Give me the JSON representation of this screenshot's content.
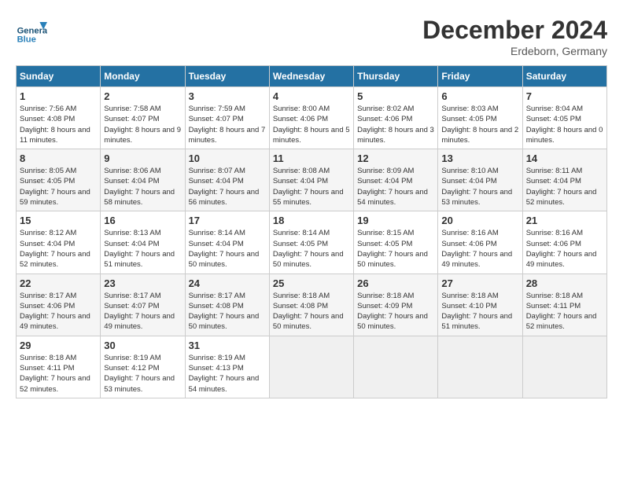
{
  "logo": {
    "general": "General",
    "blue": "Blue"
  },
  "header": {
    "month": "December 2024",
    "location": "Erdeborn, Germany"
  },
  "weekdays": [
    "Sunday",
    "Monday",
    "Tuesday",
    "Wednesday",
    "Thursday",
    "Friday",
    "Saturday"
  ],
  "days": [
    {
      "num": "",
      "sunrise": "",
      "sunset": "",
      "daylight": ""
    },
    {
      "num": "",
      "sunrise": "",
      "sunset": "",
      "daylight": ""
    },
    {
      "num": "",
      "sunrise": "",
      "sunset": "",
      "daylight": ""
    },
    {
      "num": "",
      "sunrise": "",
      "sunset": "",
      "daylight": ""
    },
    {
      "num": "",
      "sunrise": "",
      "sunset": "",
      "daylight": ""
    },
    {
      "num": "",
      "sunrise": "",
      "sunset": "",
      "daylight": ""
    },
    {
      "num": "",
      "sunrise": "",
      "sunset": "",
      "daylight": ""
    },
    {
      "num": "1",
      "sunrise": "Sunrise: 7:56 AM",
      "sunset": "Sunset: 4:08 PM",
      "daylight": "Daylight: 8 hours and 11 minutes."
    },
    {
      "num": "2",
      "sunrise": "Sunrise: 7:58 AM",
      "sunset": "Sunset: 4:07 PM",
      "daylight": "Daylight: 8 hours and 9 minutes."
    },
    {
      "num": "3",
      "sunrise": "Sunrise: 7:59 AM",
      "sunset": "Sunset: 4:07 PM",
      "daylight": "Daylight: 8 hours and 7 minutes."
    },
    {
      "num": "4",
      "sunrise": "Sunrise: 8:00 AM",
      "sunset": "Sunset: 4:06 PM",
      "daylight": "Daylight: 8 hours and 5 minutes."
    },
    {
      "num": "5",
      "sunrise": "Sunrise: 8:02 AM",
      "sunset": "Sunset: 4:06 PM",
      "daylight": "Daylight: 8 hours and 3 minutes."
    },
    {
      "num": "6",
      "sunrise": "Sunrise: 8:03 AM",
      "sunset": "Sunset: 4:05 PM",
      "daylight": "Daylight: 8 hours and 2 minutes."
    },
    {
      "num": "7",
      "sunrise": "Sunrise: 8:04 AM",
      "sunset": "Sunset: 4:05 PM",
      "daylight": "Daylight: 8 hours and 0 minutes."
    },
    {
      "num": "8",
      "sunrise": "Sunrise: 8:05 AM",
      "sunset": "Sunset: 4:05 PM",
      "daylight": "Daylight: 7 hours and 59 minutes."
    },
    {
      "num": "9",
      "sunrise": "Sunrise: 8:06 AM",
      "sunset": "Sunset: 4:04 PM",
      "daylight": "Daylight: 7 hours and 58 minutes."
    },
    {
      "num": "10",
      "sunrise": "Sunrise: 8:07 AM",
      "sunset": "Sunset: 4:04 PM",
      "daylight": "Daylight: 7 hours and 56 minutes."
    },
    {
      "num": "11",
      "sunrise": "Sunrise: 8:08 AM",
      "sunset": "Sunset: 4:04 PM",
      "daylight": "Daylight: 7 hours and 55 minutes."
    },
    {
      "num": "12",
      "sunrise": "Sunrise: 8:09 AM",
      "sunset": "Sunset: 4:04 PM",
      "daylight": "Daylight: 7 hours and 54 minutes."
    },
    {
      "num": "13",
      "sunrise": "Sunrise: 8:10 AM",
      "sunset": "Sunset: 4:04 PM",
      "daylight": "Daylight: 7 hours and 53 minutes."
    },
    {
      "num": "14",
      "sunrise": "Sunrise: 8:11 AM",
      "sunset": "Sunset: 4:04 PM",
      "daylight": "Daylight: 7 hours and 52 minutes."
    },
    {
      "num": "15",
      "sunrise": "Sunrise: 8:12 AM",
      "sunset": "Sunset: 4:04 PM",
      "daylight": "Daylight: 7 hours and 52 minutes."
    },
    {
      "num": "16",
      "sunrise": "Sunrise: 8:13 AM",
      "sunset": "Sunset: 4:04 PM",
      "daylight": "Daylight: 7 hours and 51 minutes."
    },
    {
      "num": "17",
      "sunrise": "Sunrise: 8:14 AM",
      "sunset": "Sunset: 4:04 PM",
      "daylight": "Daylight: 7 hours and 50 minutes."
    },
    {
      "num": "18",
      "sunrise": "Sunrise: 8:14 AM",
      "sunset": "Sunset: 4:05 PM",
      "daylight": "Daylight: 7 hours and 50 minutes."
    },
    {
      "num": "19",
      "sunrise": "Sunrise: 8:15 AM",
      "sunset": "Sunset: 4:05 PM",
      "daylight": "Daylight: 7 hours and 50 minutes."
    },
    {
      "num": "20",
      "sunrise": "Sunrise: 8:16 AM",
      "sunset": "Sunset: 4:06 PM",
      "daylight": "Daylight: 7 hours and 49 minutes."
    },
    {
      "num": "21",
      "sunrise": "Sunrise: 8:16 AM",
      "sunset": "Sunset: 4:06 PM",
      "daylight": "Daylight: 7 hours and 49 minutes."
    },
    {
      "num": "22",
      "sunrise": "Sunrise: 8:17 AM",
      "sunset": "Sunset: 4:06 PM",
      "daylight": "Daylight: 7 hours and 49 minutes."
    },
    {
      "num": "23",
      "sunrise": "Sunrise: 8:17 AM",
      "sunset": "Sunset: 4:07 PM",
      "daylight": "Daylight: 7 hours and 49 minutes."
    },
    {
      "num": "24",
      "sunrise": "Sunrise: 8:17 AM",
      "sunset": "Sunset: 4:08 PM",
      "daylight": "Daylight: 7 hours and 50 minutes."
    },
    {
      "num": "25",
      "sunrise": "Sunrise: 8:18 AM",
      "sunset": "Sunset: 4:08 PM",
      "daylight": "Daylight: 7 hours and 50 minutes."
    },
    {
      "num": "26",
      "sunrise": "Sunrise: 8:18 AM",
      "sunset": "Sunset: 4:09 PM",
      "daylight": "Daylight: 7 hours and 50 minutes."
    },
    {
      "num": "27",
      "sunrise": "Sunrise: 8:18 AM",
      "sunset": "Sunset: 4:10 PM",
      "daylight": "Daylight: 7 hours and 51 minutes."
    },
    {
      "num": "28",
      "sunrise": "Sunrise: 8:18 AM",
      "sunset": "Sunset: 4:11 PM",
      "daylight": "Daylight: 7 hours and 52 minutes."
    },
    {
      "num": "29",
      "sunrise": "Sunrise: 8:18 AM",
      "sunset": "Sunset: 4:11 PM",
      "daylight": "Daylight: 7 hours and 52 minutes."
    },
    {
      "num": "30",
      "sunrise": "Sunrise: 8:19 AM",
      "sunset": "Sunset: 4:12 PM",
      "daylight": "Daylight: 7 hours and 53 minutes."
    },
    {
      "num": "31",
      "sunrise": "Sunrise: 8:19 AM",
      "sunset": "Sunset: 4:13 PM",
      "daylight": "Daylight: 7 hours and 54 minutes."
    }
  ]
}
